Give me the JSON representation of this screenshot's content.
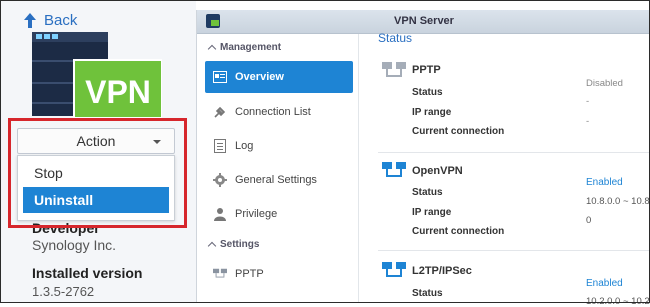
{
  "back": {
    "label": "Back"
  },
  "package": {
    "logo_text": "VPN"
  },
  "action": {
    "label": "Action",
    "menu": [
      {
        "label": "Stop"
      },
      {
        "label": "Uninstall"
      }
    ]
  },
  "info": {
    "developer_label": "Developer",
    "developer_value": "Synology Inc.",
    "installed_version_label": "Installed version",
    "installed_version_value": "1.3.5-2762"
  },
  "window": {
    "title": "VPN Server"
  },
  "sidebar": {
    "sections": [
      {
        "label": "Management"
      },
      {
        "label": "Settings"
      }
    ],
    "items": [
      {
        "label": "Overview",
        "icon": "overview-icon"
      },
      {
        "label": "Connection List",
        "icon": "plug-icon"
      },
      {
        "label": "Log",
        "icon": "document-icon"
      },
      {
        "label": "General Settings",
        "icon": "gear-icon"
      },
      {
        "label": "Privilege",
        "icon": "user-icon"
      },
      {
        "label": "PPTP",
        "icon": "network-icon"
      }
    ]
  },
  "content": {
    "status_heading": "Status",
    "protocols": [
      {
        "name": "PPTP",
        "rows": [
          {
            "label": "Status",
            "value": "Disabled"
          },
          {
            "label": "IP range",
            "value": "-"
          },
          {
            "label": "Current connection",
            "value": "-"
          }
        ]
      },
      {
        "name": "OpenVPN",
        "rows": [
          {
            "label": "Status",
            "value": "Enabled"
          },
          {
            "label": "IP range",
            "value": "10.8.0.0 ~ 10.8"
          },
          {
            "label": "Current connection",
            "value": "0"
          }
        ]
      },
      {
        "name": "L2TP/IPSec",
        "rows": [
          {
            "label": "Status",
            "value": "Enabled"
          },
          {
            "label": "IP range",
            "value": "10.2.0.0 ~ 10.2"
          }
        ]
      }
    ]
  },
  "colors": {
    "accent": "#1e84d4",
    "highlight_border": "#d6262c",
    "vpn_green": "#6fc23b"
  }
}
